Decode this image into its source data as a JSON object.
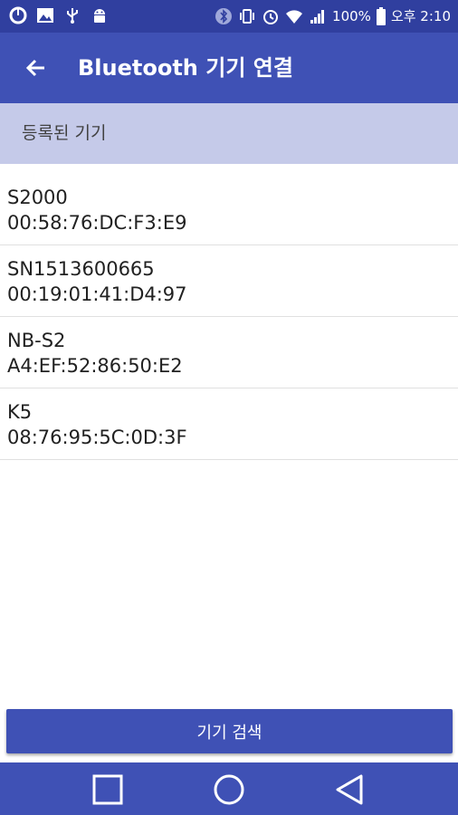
{
  "status_bar": {
    "battery_text": "100%",
    "time": "오후 2:10",
    "left_icons": [
      "sync-icon",
      "image-icon",
      "usb-icon",
      "android-icon"
    ],
    "right_icons": [
      "bluetooth-icon",
      "vibrate-icon",
      "alarm-icon",
      "wifi-icon",
      "signal-icon",
      "battery-icon"
    ]
  },
  "app_bar": {
    "title": "Bluetooth 기기 연결",
    "back_icon": "arrow-back-icon",
    "color": "#3f51b5"
  },
  "section": {
    "label": "등록된 기기",
    "color": "#c5cae9"
  },
  "devices": [
    {
      "name": "S2000",
      "address": "00:58:76:DC:F3:E9"
    },
    {
      "name": "SN1513600665",
      "address": "00:19:01:41:D4:97"
    },
    {
      "name": "NB-S2",
      "address": "A4:EF:52:86:50:E2"
    },
    {
      "name": "K5",
      "address": "08:76:95:5C:0D:3F"
    }
  ],
  "scan_button": {
    "label": "기기 검색"
  },
  "nav_bar": {
    "icons": [
      "recents-square-icon",
      "home-circle-icon",
      "back-triangle-icon"
    ]
  }
}
